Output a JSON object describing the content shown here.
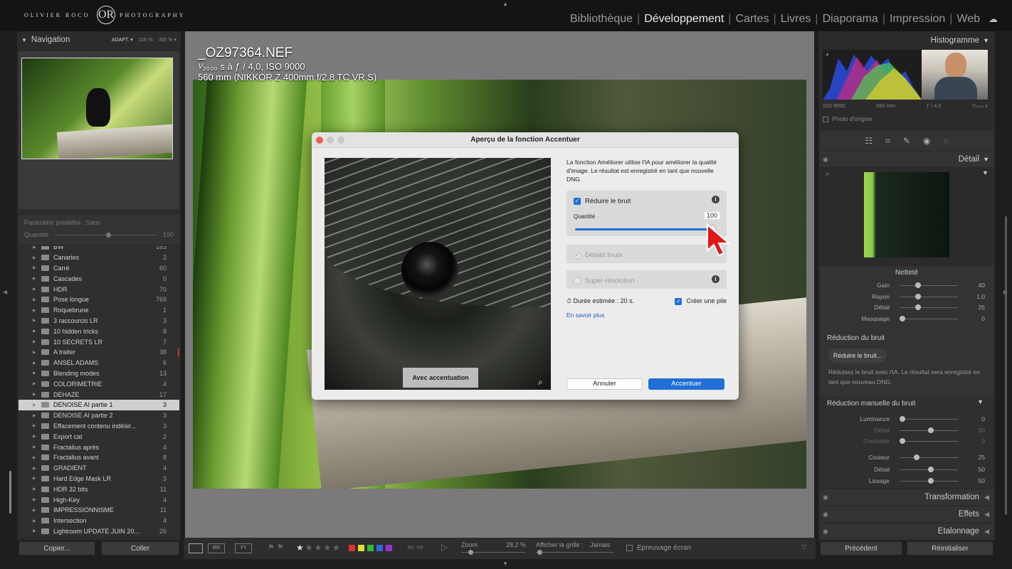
{
  "topbar": {
    "logo_left": "OLIVIER ROCO",
    "logo_mid": "OR",
    "logo_right": "PHOTOGRAPHY",
    "modules": [
      "Bibliothèque",
      "Développement",
      "Cartes",
      "Livres",
      "Diaporama",
      "Impression",
      "Web"
    ],
    "active_module": "Développement"
  },
  "left": {
    "nav_title": "Navigation",
    "nav_zoom": [
      "ADAPT. ▾",
      "100 %",
      "300 % ▾"
    ],
    "preset_label": "Paramètre prédéfini : Sans",
    "preset_qty_label": "Quantité",
    "preset_qty_value": "100",
    "collections": [
      {
        "name": "BW",
        "count": "163"
      },
      {
        "name": "Canaries",
        "count": "2"
      },
      {
        "name": "Carré",
        "count": "60"
      },
      {
        "name": "Cascades",
        "count": "0"
      },
      {
        "name": "HDR",
        "count": "70"
      },
      {
        "name": "Pose longue",
        "count": "769"
      },
      {
        "name": "Roquebrune",
        "count": "1"
      },
      {
        "name": "3 raccourcis LR",
        "count": "3"
      },
      {
        "name": "10 hidden tricks",
        "count": "8"
      },
      {
        "name": "10 SECRETS LR",
        "count": "7"
      },
      {
        "name": "A traiter",
        "count": "38"
      },
      {
        "name": "ANSEL ADAMS",
        "count": "6"
      },
      {
        "name": "Blending modes",
        "count": "13"
      },
      {
        "name": "COLORIMETRIE",
        "count": "4"
      },
      {
        "name": "DEHAZE",
        "count": "17"
      },
      {
        "name": "DENOISE AI partie 1",
        "count": "3"
      },
      {
        "name": "DENOISE AI partie 2",
        "count": "3"
      },
      {
        "name": "Effacement contenu indésir...",
        "count": "3"
      },
      {
        "name": "Export cat",
        "count": "2"
      },
      {
        "name": "Fractalius après",
        "count": "4"
      },
      {
        "name": "Fractalius avant",
        "count": "8"
      },
      {
        "name": "GRADIENT",
        "count": "4"
      },
      {
        "name": "Hard Edge Mask LR",
        "count": "3"
      },
      {
        "name": "HDR 32 bits",
        "count": "11"
      },
      {
        "name": "High-Key",
        "count": "4"
      },
      {
        "name": "IMPRESSIONNISME",
        "count": "11"
      },
      {
        "name": "Intersection",
        "count": "4"
      },
      {
        "name": "Lightroom UPDATE JUIN 20...",
        "count": "26"
      }
    ],
    "copy_btn": "Copier...",
    "paste_btn": "Coller"
  },
  "photo": {
    "filename": "_OZ97364.NEF",
    "exif1": "¹⁄₂₀₀₀ s à ƒ / 4,0, ISO 9000",
    "exif2": "560 mm (NIKKOR Z 400mm f/2.8 TC VR S)"
  },
  "dialog": {
    "title": "Aperçu de la fonction Accentuer",
    "description": "La fonction Améliorer utilise l'IA pour améliorer la qualité d'image. Le résultat est enregistré en tant que nouvelle DNG.",
    "preview_button": "Avec accentuation",
    "reduce_noise": "Réduire le bruit",
    "quantity_label": "Quantité",
    "quantity_value": "100",
    "raw_details": "Détails bruts",
    "super_resolution": "Super-résolution",
    "duration": "Durée estimée : 20 s.",
    "create_stack": "Créer une pile",
    "learn_more": "En savoir plus",
    "cancel": "Annuler",
    "confirm": "Accentuer"
  },
  "filmstrip": {
    "zoom_label": "Zoom",
    "zoom_value": "28,2 %",
    "grid_label": "Afficher la grille :",
    "grid_value": "Jamais",
    "softproof": "Epreuvage écran"
  },
  "right": {
    "histogram_title": "Histogramme",
    "hist_info": [
      "ISO 9000",
      "560 mm",
      "ƒ / 4,0",
      "¹⁄₂₀₀₀ s"
    ],
    "original_photo": "Photo d'origine",
    "detail_title": "Détail",
    "sharpening_title": "Netteté",
    "sharpening": [
      {
        "label": "Gain",
        "value": "40",
        "pos": 0.27
      },
      {
        "label": "Rayon",
        "value": "1,0",
        "pos": 0.27
      },
      {
        "label": "Détail",
        "value": "25",
        "pos": 0.27
      },
      {
        "label": "Masquage",
        "value": "0",
        "pos": 0.0
      }
    ],
    "noise_title": "Réduction du bruit",
    "noise_button": "Réduire le bruit...",
    "noise_desc": "Réduisez le bruit avec l'IA. Le résultat sera enregistré en tant que nouveau DNG.",
    "manual_noise_title": "Réduction manuelle du bruit",
    "manual_noise": [
      {
        "label": "Luminance",
        "value": "0",
        "pos": 0.0,
        "dim": false
      },
      {
        "label": "Détail",
        "value": "50",
        "pos": 0.5,
        "dim": true
      },
      {
        "label": "Contraste",
        "value": "0",
        "pos": 0.0,
        "dim": true
      },
      {
        "label": "Couleur",
        "value": "25",
        "pos": 0.25,
        "dim": false
      },
      {
        "label": "Détail",
        "value": "50",
        "pos": 0.5,
        "dim": false
      },
      {
        "label": "Lissage",
        "value": "50",
        "pos": 0.5,
        "dim": false
      }
    ],
    "transformation": "Transformation",
    "effects": "Effets",
    "calibration": "Etalonnage",
    "prev_btn": "Précédent",
    "reset_btn": "Réinitialiser"
  }
}
